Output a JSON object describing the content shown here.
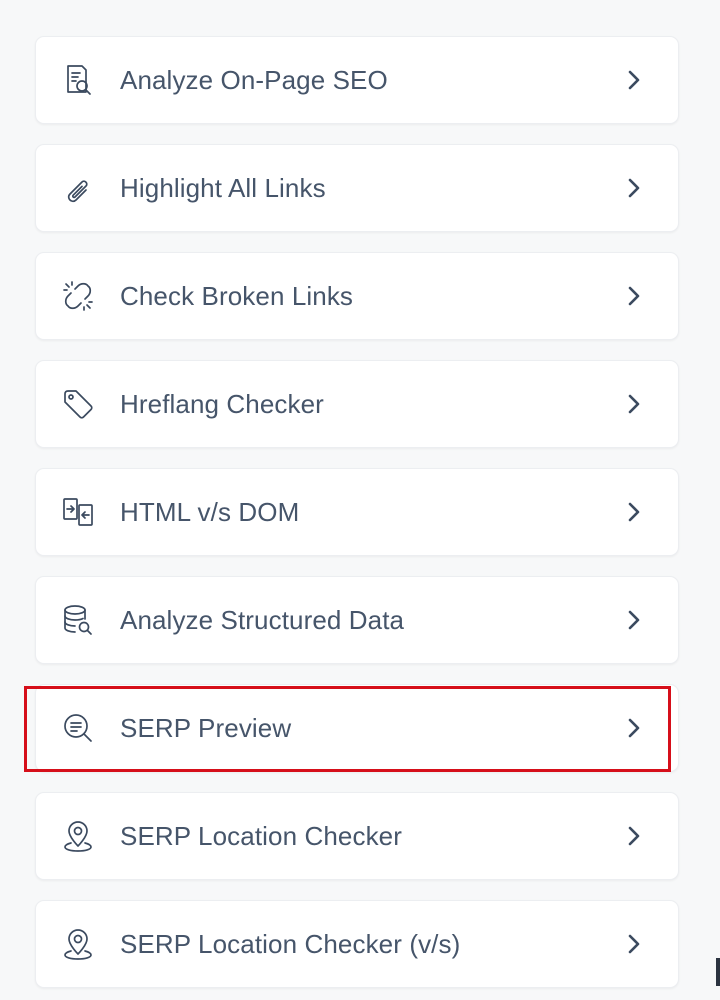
{
  "menu": {
    "items": [
      {
        "label": "Analyze On-Page SEO",
        "icon": "document-search-icon"
      },
      {
        "label": "Highlight All Links",
        "icon": "paperclip-icon"
      },
      {
        "label": "Check Broken Links",
        "icon": "broken-link-icon"
      },
      {
        "label": "Hreflang Checker",
        "icon": "tag-icon"
      },
      {
        "label": "HTML v/s DOM",
        "icon": "compare-icon"
      },
      {
        "label": "Analyze Structured Data",
        "icon": "database-search-icon"
      },
      {
        "label": "SERP Preview",
        "icon": "search-lines-icon"
      },
      {
        "label": "SERP Location Checker",
        "icon": "location-pin-icon"
      },
      {
        "label": "SERP Location Checker (v/s)",
        "icon": "location-pin-icon"
      }
    ],
    "chevron_icon": "chevron-right-icon",
    "highlighted_item": "SERP Preview",
    "highlight_color": "#d60f1a",
    "text_color": "#46556a"
  }
}
